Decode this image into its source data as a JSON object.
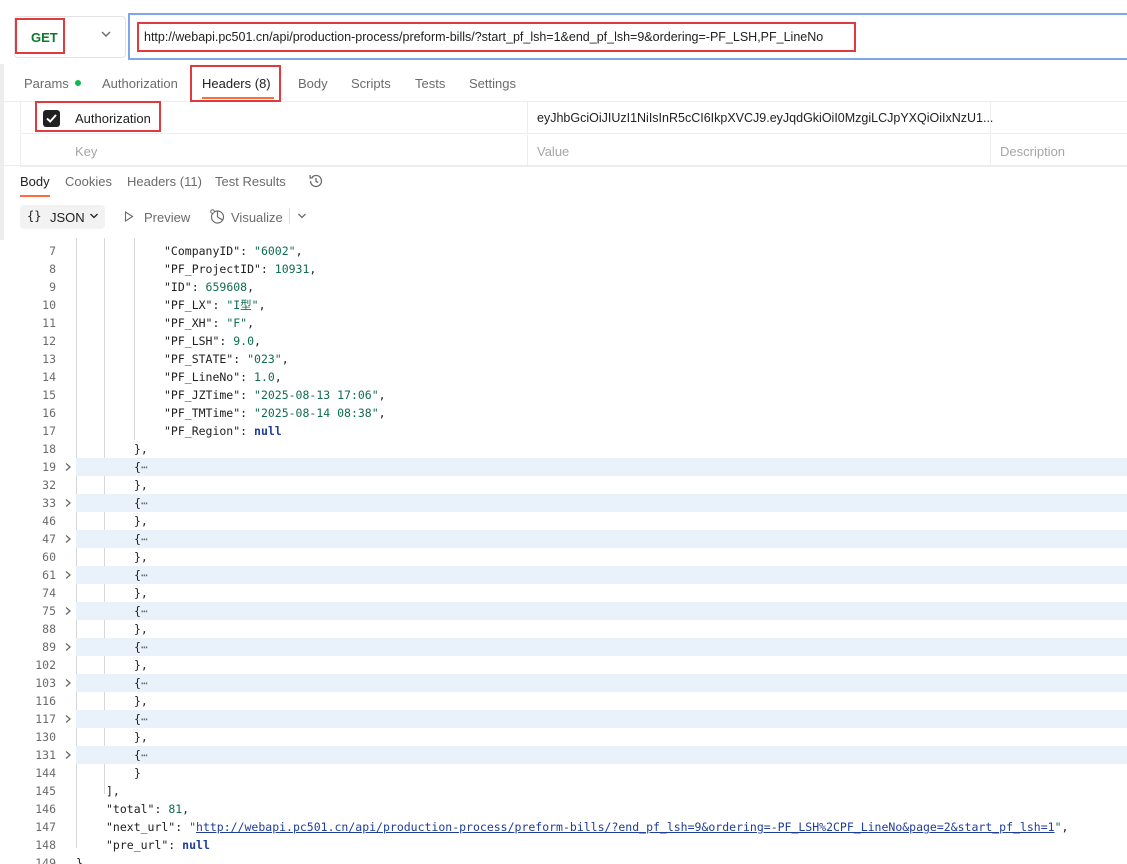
{
  "request": {
    "method": "GET",
    "url": "http://webapi.pc501.cn/api/production-process/preform-bills/?start_pf_lsh=1&end_pf_lsh=9&ordering=-PF_LSH,PF_LineNo"
  },
  "request_tabs": [
    {
      "label": "Params",
      "dot": true
    },
    {
      "label": "Authorization"
    },
    {
      "label": "Headers (8)",
      "active": true
    },
    {
      "label": "Body"
    },
    {
      "label": "Scripts"
    },
    {
      "label": "Tests"
    },
    {
      "label": "Settings"
    }
  ],
  "headers_table": {
    "row": {
      "checked": true,
      "key": "Authorization",
      "value": "eyJhbGciOiJIUzI1NiIsInR5cCI6IkpXVCJ9.eyJqdGkiOiI0MzgiLCJpYXQiOiIxNzU1..."
    },
    "placeholders": {
      "key": "Key",
      "value": "Value",
      "description": "Description"
    }
  },
  "response_tabs": [
    {
      "label": "Body",
      "active": true
    },
    {
      "label": "Cookies"
    },
    {
      "label": "Headers (11)"
    },
    {
      "label": "Test Results"
    }
  ],
  "response_toolbar": {
    "format": "JSON",
    "preview": "Preview",
    "visualize": "Visualize"
  },
  "code_lines": [
    {
      "n": "7",
      "indent": 3,
      "parts": [
        [
          "k",
          "\"CompanyID\": "
        ],
        [
          "s",
          "\"6002\""
        ],
        [
          "k",
          ","
        ]
      ]
    },
    {
      "n": "8",
      "indent": 3,
      "parts": [
        [
          "k",
          "\"PF_ProjectID\": "
        ],
        [
          "n",
          "10931"
        ],
        [
          "k",
          ","
        ]
      ]
    },
    {
      "n": "9",
      "indent": 3,
      "parts": [
        [
          "k",
          "\"ID\": "
        ],
        [
          "n",
          "659608"
        ],
        [
          "k",
          ","
        ]
      ]
    },
    {
      "n": "10",
      "indent": 3,
      "parts": [
        [
          "k",
          "\"PF_LX\": "
        ],
        [
          "s",
          "\"I型\""
        ],
        [
          "k",
          ","
        ]
      ]
    },
    {
      "n": "11",
      "indent": 3,
      "parts": [
        [
          "k",
          "\"PF_XH\": "
        ],
        [
          "s",
          "\"F\""
        ],
        [
          "k",
          ","
        ]
      ]
    },
    {
      "n": "12",
      "indent": 3,
      "parts": [
        [
          "k",
          "\"PF_LSH\": "
        ],
        [
          "n",
          "9.0"
        ],
        [
          "k",
          ","
        ]
      ]
    },
    {
      "n": "13",
      "indent": 3,
      "parts": [
        [
          "k",
          "\"PF_STATE\": "
        ],
        [
          "s",
          "\"023\""
        ],
        [
          "k",
          ","
        ]
      ]
    },
    {
      "n": "14",
      "indent": 3,
      "parts": [
        [
          "k",
          "\"PF_LineNo\": "
        ],
        [
          "n",
          "1.0"
        ],
        [
          "k",
          ","
        ]
      ]
    },
    {
      "n": "15",
      "indent": 3,
      "parts": [
        [
          "k",
          "\"PF_JZTime\": "
        ],
        [
          "s",
          "\"2025-08-13 17:06\""
        ],
        [
          "k",
          ","
        ]
      ]
    },
    {
      "n": "16",
      "indent": 3,
      "parts": [
        [
          "k",
          "\"PF_TMTime\": "
        ],
        [
          "s",
          "\"2025-08-14 08:38\""
        ],
        [
          "k",
          ","
        ]
      ]
    },
    {
      "n": "17",
      "indent": 3,
      "parts": [
        [
          "k",
          "\"PF_Region\": "
        ],
        [
          "nl",
          "null"
        ]
      ]
    },
    {
      "n": "18",
      "indent": 2,
      "parts": [
        [
          "k",
          "},"
        ]
      ]
    },
    {
      "n": "19",
      "indent": 2,
      "fold": true,
      "parts": [
        [
          "k",
          "{"
        ],
        [
          "dots",
          "⋯"
        ]
      ]
    },
    {
      "n": "32",
      "indent": 2,
      "parts": [
        [
          "k",
          "},"
        ]
      ]
    },
    {
      "n": "33",
      "indent": 2,
      "fold": true,
      "parts": [
        [
          "k",
          "{"
        ],
        [
          "dots",
          "⋯"
        ]
      ]
    },
    {
      "n": "46",
      "indent": 2,
      "parts": [
        [
          "k",
          "},"
        ]
      ]
    },
    {
      "n": "47",
      "indent": 2,
      "fold": true,
      "parts": [
        [
          "k",
          "{"
        ],
        [
          "dots",
          "⋯"
        ]
      ]
    },
    {
      "n": "60",
      "indent": 2,
      "parts": [
        [
          "k",
          "},"
        ]
      ]
    },
    {
      "n": "61",
      "indent": 2,
      "fold": true,
      "parts": [
        [
          "k",
          "{"
        ],
        [
          "dots",
          "⋯"
        ]
      ]
    },
    {
      "n": "74",
      "indent": 2,
      "parts": [
        [
          "k",
          "},"
        ]
      ]
    },
    {
      "n": "75",
      "indent": 2,
      "fold": true,
      "parts": [
        [
          "k",
          "{"
        ],
        [
          "dots",
          "⋯"
        ]
      ]
    },
    {
      "n": "88",
      "indent": 2,
      "parts": [
        [
          "k",
          "},"
        ]
      ]
    },
    {
      "n": "89",
      "indent": 2,
      "fold": true,
      "parts": [
        [
          "k",
          "{"
        ],
        [
          "dots",
          "⋯"
        ]
      ]
    },
    {
      "n": "102",
      "indent": 2,
      "parts": [
        [
          "k",
          "},"
        ]
      ]
    },
    {
      "n": "103",
      "indent": 2,
      "fold": true,
      "parts": [
        [
          "k",
          "{"
        ],
        [
          "dots",
          "⋯"
        ]
      ]
    },
    {
      "n": "116",
      "indent": 2,
      "parts": [
        [
          "k",
          "},"
        ]
      ]
    },
    {
      "n": "117",
      "indent": 2,
      "fold": true,
      "parts": [
        [
          "k",
          "{"
        ],
        [
          "dots",
          "⋯"
        ]
      ]
    },
    {
      "n": "130",
      "indent": 2,
      "parts": [
        [
          "k",
          "},"
        ]
      ]
    },
    {
      "n": "131",
      "indent": 2,
      "fold": true,
      "parts": [
        [
          "k",
          "{"
        ],
        [
          "dots",
          "⋯"
        ]
      ]
    },
    {
      "n": "144",
      "indent": 2,
      "parts": [
        [
          "k",
          "}"
        ]
      ]
    },
    {
      "n": "145",
      "indent": 1,
      "parts": [
        [
          "k",
          "],"
        ]
      ]
    },
    {
      "n": "146",
      "indent": 1,
      "parts": [
        [
          "k",
          "\"total\": "
        ],
        [
          "n",
          "81"
        ],
        [
          "k",
          ","
        ]
      ]
    },
    {
      "n": "147",
      "indent": 1,
      "parts": [
        [
          "k",
          "\"next_url\": "
        ],
        [
          "s",
          "\""
        ],
        [
          "u",
          "http://webapi.pc501.cn/api/production-process/preform-bills/?end_pf_lsh=9&ordering=-PF_LSH%2CPF_LineNo&page=2&start_pf_lsh=1"
        ],
        [
          "s",
          "\""
        ],
        [
          "k",
          ","
        ]
      ]
    },
    {
      "n": "148",
      "indent": 1,
      "parts": [
        [
          "k",
          "\"pre_url\": "
        ],
        [
          "nl",
          "null"
        ]
      ]
    },
    {
      "n": "149",
      "indent": 0,
      "parts": [
        [
          "k",
          "}"
        ]
      ]
    }
  ]
}
